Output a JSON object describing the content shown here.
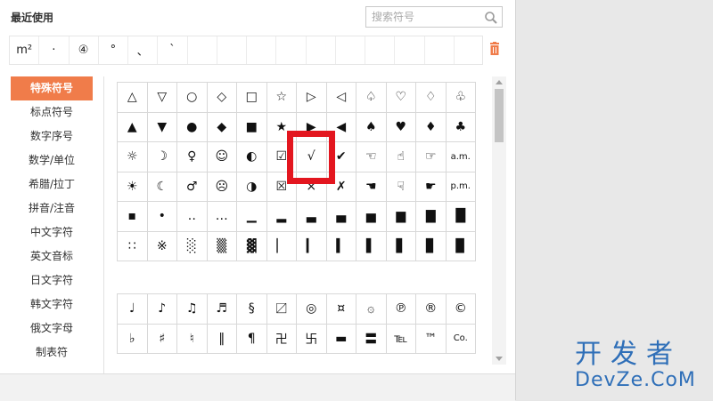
{
  "recent": {
    "title": "最近使用",
    "symbols": [
      "m²",
      "·",
      "④",
      "°",
      "、",
      "`",
      "",
      "",
      "",
      "",
      "",
      "",
      "",
      "",
      "",
      ""
    ]
  },
  "search": {
    "placeholder": "搜索符号"
  },
  "categories": [
    {
      "label": "特殊符号",
      "active": true
    },
    {
      "label": "标点符号"
    },
    {
      "label": "数字序号"
    },
    {
      "label": "数学/单位"
    },
    {
      "label": "希腊/拉丁"
    },
    {
      "label": "拼音/注音"
    },
    {
      "label": "中文字符"
    },
    {
      "label": "英文音标"
    },
    {
      "label": "日文字符"
    },
    {
      "label": "韩文字符"
    },
    {
      "label": "俄文字母"
    },
    {
      "label": "制表符"
    }
  ],
  "grid1": [
    [
      "△",
      "▽",
      "○",
      "◇",
      "□",
      "☆",
      "▷",
      "◁",
      "♤",
      "♡",
      "♢",
      "♧"
    ],
    [
      "▲",
      "▼",
      "●",
      "◆",
      "■",
      "★",
      "▶",
      "◀",
      "♠",
      "♥",
      "♦",
      "♣"
    ],
    [
      "☼",
      "☽",
      "♀",
      "☺",
      "◐",
      "☑",
      "√",
      "✔",
      "☜",
      "☝",
      "☞",
      "a.m."
    ],
    [
      "☀",
      "☾",
      "♂",
      "☹",
      "◑",
      "☒",
      "×",
      "✗",
      "☚",
      "☟",
      "☛",
      "p.m."
    ],
    [
      "▪",
      "•",
      "‥",
      "…",
      "▁",
      "▂",
      "▃",
      "▄",
      "▅",
      "▆",
      "▇",
      "█"
    ],
    [
      "∷",
      "※",
      "░",
      "▒",
      "▓",
      "▏",
      "▎",
      "▍",
      "▌",
      "▋",
      "▊",
      "▉"
    ]
  ],
  "grid2": [
    [
      "♩",
      "♪",
      "♫",
      "♬",
      "§",
      "〼",
      "◎",
      "¤",
      "۞",
      "℗",
      "®",
      "©"
    ],
    [
      "♭",
      "♯",
      "♮",
      "‖",
      "¶",
      "卍",
      "卐",
      "▬",
      "〓",
      "℡",
      "™",
      "Co."
    ]
  ],
  "watermark": {
    "line1": "开发者",
    "line2": "DevZe.CoM"
  }
}
